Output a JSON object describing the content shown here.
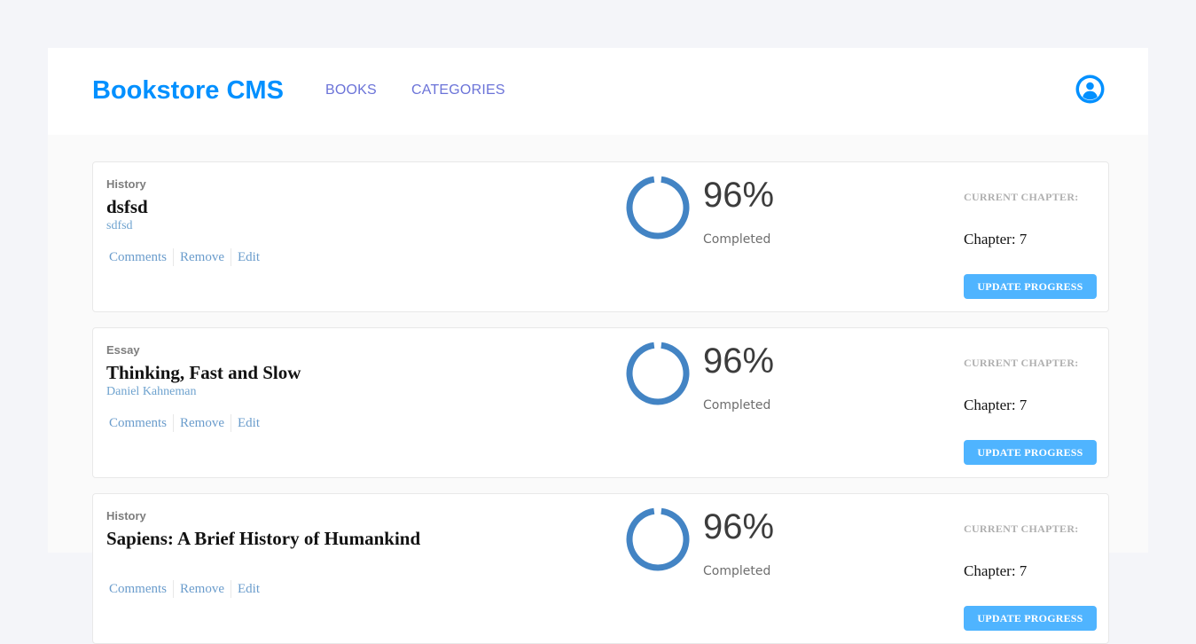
{
  "header": {
    "logo": "Bookstore CMS",
    "nav": [
      {
        "label": "BOOKS"
      },
      {
        "label": "CATEGORIES"
      }
    ],
    "user_icon": "user-circle-icon"
  },
  "colors": {
    "brand": "#0290ff",
    "nav_link": "#6b73d8",
    "progress_ring": "#4384c4",
    "button": "#4fb4ff"
  },
  "books": [
    {
      "genre": "History",
      "title": "dsfsd",
      "author": "sdfsd",
      "actions": [
        "Comments",
        "Remove",
        "Edit"
      ],
      "progress_percent": 96,
      "progress_label": "96%",
      "completed_label": "Completed",
      "current_chapter_label": "CURRENT CHAPTER:",
      "chapter": "Chapter: 7",
      "update_label": "UPDATE PROGRESS"
    },
    {
      "genre": "Essay",
      "title": "Thinking, Fast and Slow",
      "author": "Daniel Kahneman",
      "actions": [
        "Comments",
        "Remove",
        "Edit"
      ],
      "progress_percent": 96,
      "progress_label": "96%",
      "completed_label": "Completed",
      "current_chapter_label": "CURRENT CHAPTER:",
      "chapter": "Chapter: 7",
      "update_label": "UPDATE PROGRESS"
    },
    {
      "genre": "History",
      "title": "Sapiens: A Brief History of Humankind",
      "author": "",
      "actions": [
        "Comments",
        "Remove",
        "Edit"
      ],
      "progress_percent": 96,
      "progress_label": "96%",
      "completed_label": "Completed",
      "current_chapter_label": "CURRENT CHAPTER:",
      "chapter": "Chapter: 7",
      "update_label": "UPDATE PROGRESS"
    }
  ]
}
